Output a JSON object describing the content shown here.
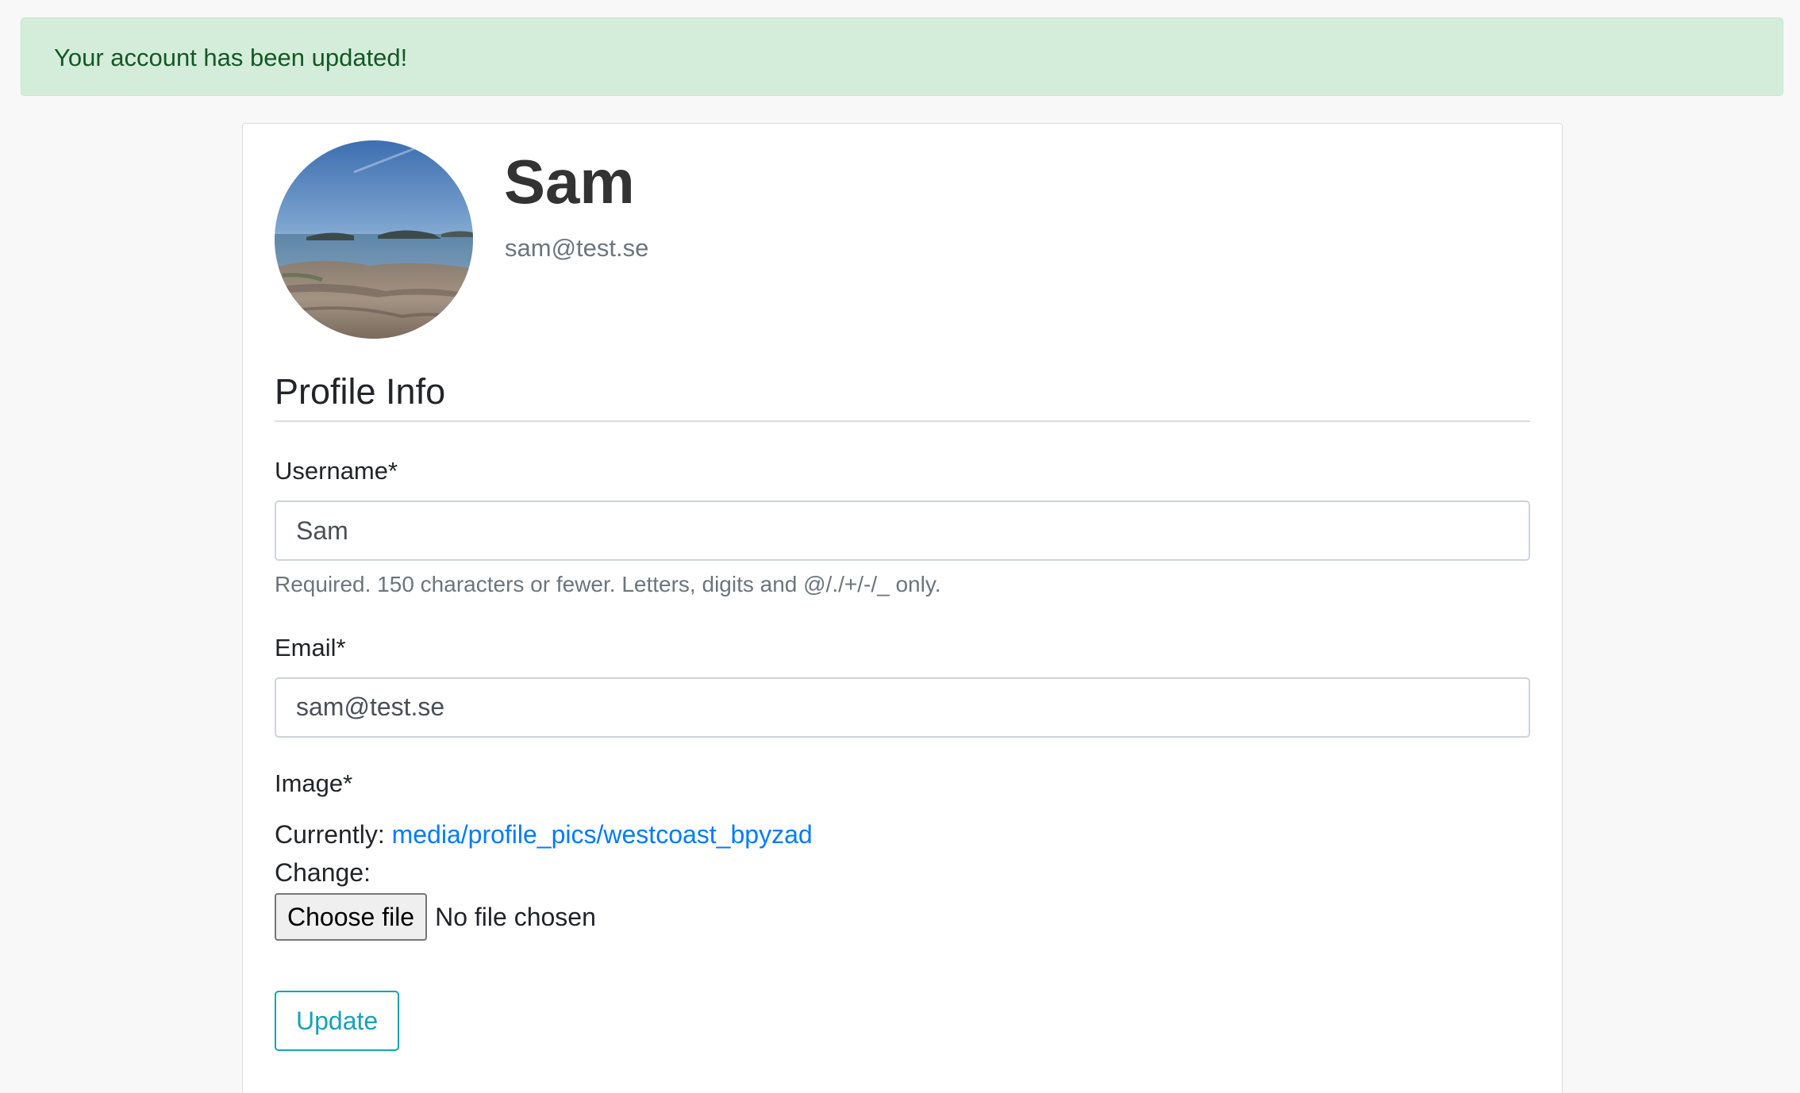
{
  "alert": {
    "message": "Your account has been updated!"
  },
  "profile": {
    "name": "Sam",
    "email": "sam@test.se",
    "avatar_icon": "profile-photo-coastline"
  },
  "form": {
    "legend": "Profile Info",
    "username": {
      "label": "Username*",
      "value": "Sam",
      "help": "Required. 150 characters or fewer. Letters, digits and @/./+/-/_ only."
    },
    "email": {
      "label": "Email*",
      "value": "sam@test.se"
    },
    "image": {
      "label": "Image*",
      "currently_label": "Currently:",
      "current_file": "media/profile_pics/westcoast_bpyzad",
      "change_label": "Change:",
      "choose_button": "Choose file",
      "no_file": "No file chosen"
    },
    "submit_label": "Update"
  },
  "colors": {
    "alert_bg": "#d4edda",
    "alert_text": "#155724",
    "link": "#007bff",
    "accent": "#17a2b8",
    "muted": "#6c757d"
  }
}
